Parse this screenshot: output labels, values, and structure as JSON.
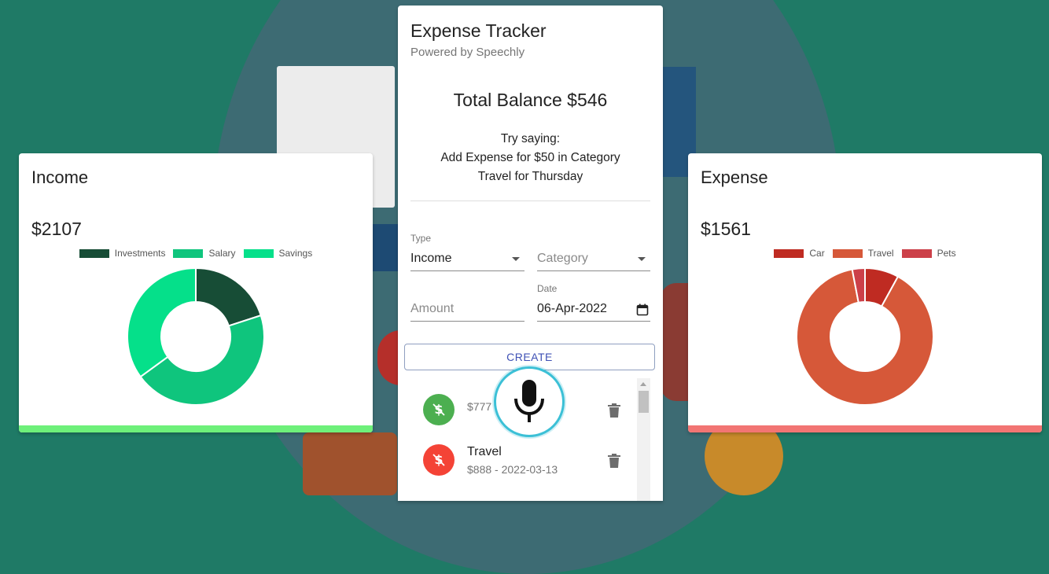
{
  "income": {
    "title": "Income",
    "amount": "$2107",
    "legend": [
      "Investments",
      "Salary",
      "Savings"
    ],
    "colors": [
      "#174d36",
      "#0fc57d",
      "#05e08a"
    ],
    "bar_color": "#6ef07a",
    "shares": [
      0.2,
      0.45,
      0.35
    ]
  },
  "expense": {
    "title": "Expense",
    "amount": "$1561",
    "legend": [
      "Car",
      "Travel",
      "Pets"
    ],
    "colors": [
      "#bf2b22",
      "#d65839",
      "#cc4049"
    ],
    "bar_color": "#f27573",
    "shares": [
      0.08,
      0.89,
      0.03
    ]
  },
  "tracker": {
    "title": "Expense Tracker",
    "subtitle": "Powered by Speechly",
    "balance": "Total Balance $546",
    "hint_line1": "Try saying:",
    "hint_line2": "Add Expense for $50 in Category",
    "hint_line3": "Travel for Thursday",
    "type_label": "Type",
    "type_value": "Income",
    "category_placeholder": "Category",
    "amount_placeholder": "Amount",
    "date_label": "Date",
    "date_value": "06-Apr-2022",
    "create_label": "CREATE"
  },
  "transactions": [
    {
      "name": "",
      "sub": "$777",
      "kind": "income",
      "color": "#4caf50"
    },
    {
      "name": "Travel",
      "sub": "$888 - 2022-03-13",
      "kind": "expense",
      "color": "#f44336"
    }
  ]
}
